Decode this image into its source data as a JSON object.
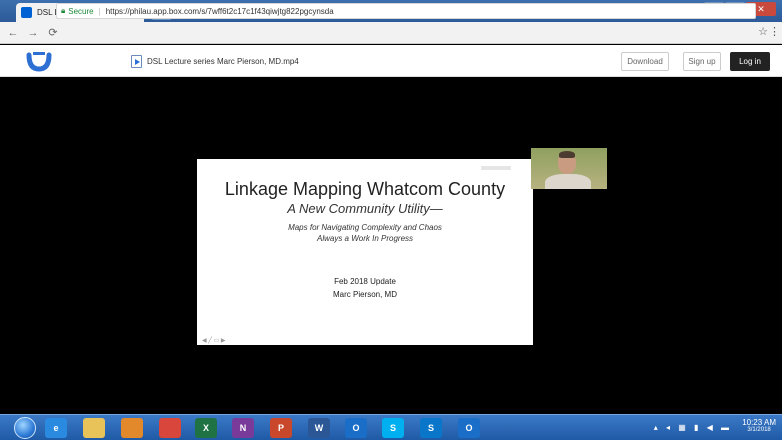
{
  "browser": {
    "tab_title": "DSL Lecture series Ma",
    "tab_audio_icon": "speaker-icon",
    "tab_close": "×",
    "secure_label": "Secure",
    "url": "https://philau.app.box.com/s/7wff6t2c17c1f43qiwjtg822pgcynsda"
  },
  "box_header": {
    "filename": "DSL Lecture series Marc Pierson, MD.mp4",
    "download_label": "Download",
    "signup_label": "Sign up",
    "login_label": "Log in"
  },
  "slide": {
    "title": "Linkage Mapping Whatcom County",
    "subtitle": "A New Community Utility—",
    "line1": "Maps for Navigating Complexity and Chaos",
    "line2": "Always a Work In Progress",
    "update": "Feb 2018 Update",
    "author": "Marc Pierson, MD"
  },
  "taskbar": {
    "apps": [
      {
        "name": "ie-icon",
        "label": "e",
        "color": "#2a8ae0"
      },
      {
        "name": "explorer-icon",
        "label": "",
        "color": "#e8c35a"
      },
      {
        "name": "media-icon",
        "label": "",
        "color": "#e28a2b"
      },
      {
        "name": "chrome-icon",
        "label": "",
        "color": "#d9463b"
      },
      {
        "name": "excel-icon",
        "label": "X",
        "color": "#1f7244"
      },
      {
        "name": "onenote-icon",
        "label": "N",
        "color": "#7a3a9a"
      },
      {
        "name": "powerpoint-icon",
        "label": "P",
        "color": "#c9472b"
      },
      {
        "name": "word-icon",
        "label": "W",
        "color": "#2b5797"
      },
      {
        "name": "outlook-icon",
        "label": "O",
        "color": "#1a6ec7"
      },
      {
        "name": "skype-icon",
        "label": "S",
        "color": "#00aff0"
      },
      {
        "name": "skype-business-icon",
        "label": "S",
        "color": "#0a76c9"
      },
      {
        "name": "outlook-icon-2",
        "label": "O",
        "color": "#1a6ec7"
      }
    ],
    "clock_time": "10:23 AM",
    "clock_date": "3/1/2018"
  }
}
